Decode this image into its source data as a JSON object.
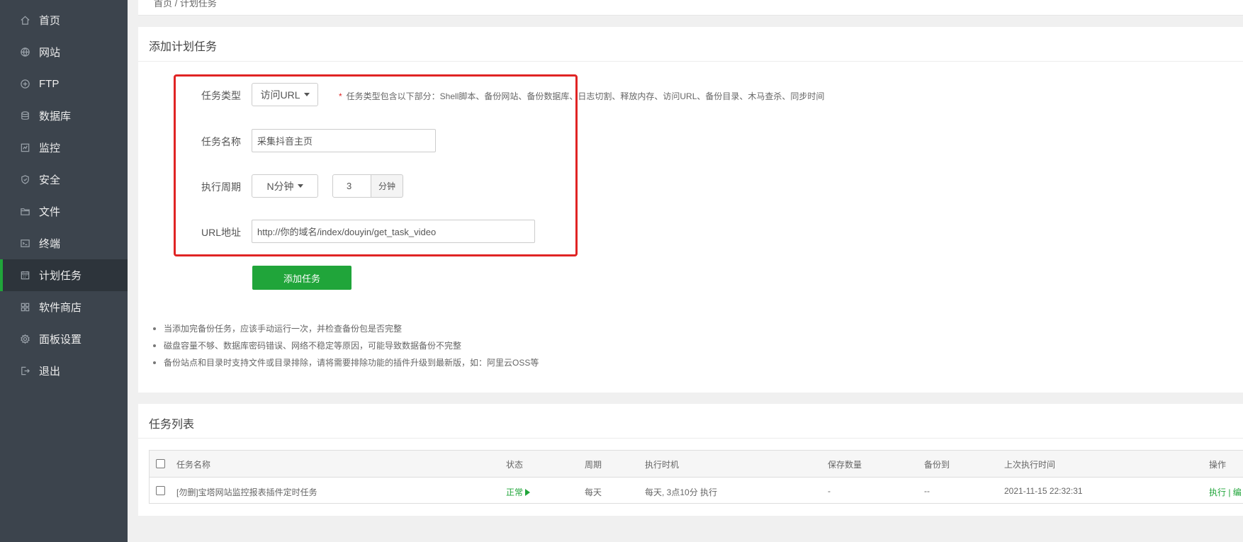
{
  "sidebar": {
    "items": [
      {
        "label": "首页",
        "icon": "home-icon"
      },
      {
        "label": "网站",
        "icon": "globe-icon"
      },
      {
        "label": "FTP",
        "icon": "ftp-icon"
      },
      {
        "label": "数据库",
        "icon": "database-icon"
      },
      {
        "label": "监控",
        "icon": "monitor-icon"
      },
      {
        "label": "安全",
        "icon": "shield-icon"
      },
      {
        "label": "文件",
        "icon": "folder-icon"
      },
      {
        "label": "终端",
        "icon": "terminal-icon"
      },
      {
        "label": "计划任务",
        "icon": "calendar-icon",
        "active": true
      },
      {
        "label": "软件商店",
        "icon": "apps-icon"
      },
      {
        "label": "面板设置",
        "icon": "gear-icon"
      },
      {
        "label": "退出",
        "icon": "logout-icon"
      }
    ]
  },
  "breadcrumb": {
    "text": "首页 / 计划任务"
  },
  "add_task": {
    "title": "添加计划任务",
    "task_type_label": "任务类型",
    "task_type_value": "访问URL",
    "task_type_hint_star": "*",
    "task_type_hint": "任务类型包含以下部分：Shell脚本、备份网站、备份数据库、日志切割、释放内存、访问URL、备份目录、木马查杀、同步时间",
    "task_name_label": "任务名称",
    "task_name_value": "采集抖音主页",
    "period_label": "执行周期",
    "period_value": "N分钟",
    "period_number": "3",
    "period_unit": "分钟",
    "url_label": "URL地址",
    "url_value": "http://你的域名/index/douyin/get_task_video",
    "submit_label": "添加任务",
    "notes": [
      "当添加完备份任务，应该手动运行一次，并检查备份包是否完整",
      "磁盘容量不够、数据库密码错误、网络不稳定等原因，可能导致数据备份不完整",
      "备份站点和目录时支持文件或目录排除，请将需要排除功能的插件升级到最新版，如：阿里云OSS等"
    ]
  },
  "task_list": {
    "title": "任务列表",
    "columns": [
      "任务名称",
      "状态",
      "周期",
      "执行时机",
      "保存数量",
      "备份到",
      "上次执行时间",
      "操作"
    ],
    "rows": [
      {
        "name": "[勿删]宝塔网站监控报表插件定时任务",
        "status": "正常",
        "period": "每天",
        "timing": "每天, 3点10分 执行",
        "keep": "-",
        "backup_to": "--",
        "last_run": "2021-11-15 22:32:31",
        "ops": "执行 | 编"
      }
    ]
  },
  "colors": {
    "sidebar_bg": "#3c444d",
    "accent_green": "#20a53a",
    "highlight_red": "#e02424"
  }
}
